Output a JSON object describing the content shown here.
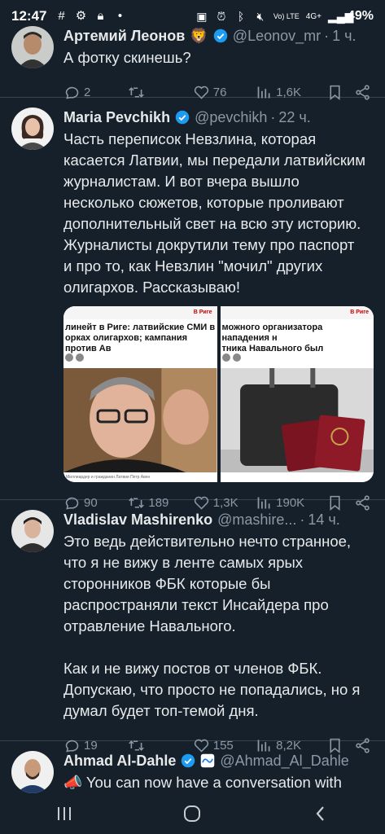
{
  "status_bar": {
    "time": "12:47",
    "battery": "49%",
    "network": "4G+",
    "volte": "Vo) LTE"
  },
  "tweets": [
    {
      "name": "Артемий Леонов",
      "badge": "🦁",
      "verified": true,
      "handle": "@Leonov_mr",
      "time": "1 ч.",
      "text": "А фотку скинешь?",
      "replies": "2",
      "retweets": "",
      "likes": "76",
      "views": "1,6K"
    },
    {
      "name": "Maria Pevchikh",
      "verified": true,
      "handle": "@pevchikh",
      "time": "22 ч.",
      "text": "Часть переписок Невзлина, которая касается Латвии, мы передали латвийским журналистам. И вот вчера вышло несколько сюжетов, которые проливают дополнительный свет на всю эту историю. Журналисты докрутили тему про паспорт и про то, как Невзлин \"мочил\" других олигархов. Рассказываю!",
      "media": [
        {
          "site": "В Риге",
          "headline": "линейт в Риге: латвийские СМИ в\nорках олигархов; кампания против Ав",
          "caption": "Миллиардер и гражданин Латвии Петр Авен"
        },
        {
          "site": "В Риге",
          "headline": "можного организатора нападения н\nтника Навального был поддельный\nийский паспорт",
          "caption": ""
        }
      ],
      "replies": "90",
      "retweets": "189",
      "likes": "1,3K",
      "views": "190K"
    },
    {
      "name": "Vladislav Mashirenko",
      "verified": false,
      "handle": "@mashire...",
      "time": "14 ч.",
      "text": "Это ведь действительно нечто странное, что я не вижу  в ленте самых ярых сторонников ФБК которые бы распространяли текст Инсайдера про отравление Навального.\n\nКак и не вижу постов от членов ФБК. Допускаю, что просто не попадались, но я думал будет топ-темой дня.",
      "replies": "19",
      "retweets": "",
      "likes": "155",
      "views": "8,2K"
    },
    {
      "name": "Ahmad Al-Dahle",
      "verified": true,
      "handle": "@Ahmad_Al_Dahle",
      "time": "",
      "text": "📣 You can now have a conversation with"
    }
  ],
  "colors": {
    "background": "#15202b",
    "verified": "#1d9bf0",
    "muted": "#8b98a5",
    "divider": "#38444d"
  }
}
